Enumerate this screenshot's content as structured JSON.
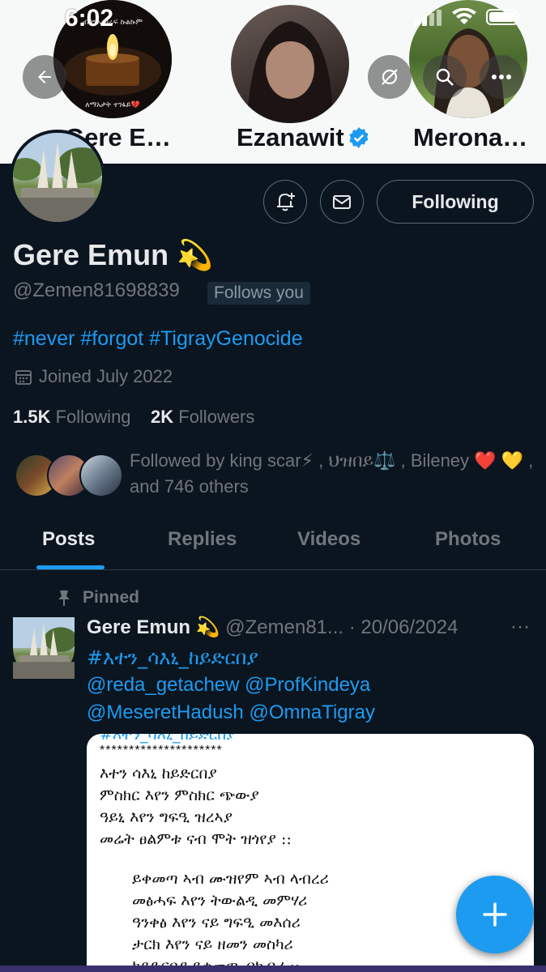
{
  "status_bar": {
    "time": "6:02"
  },
  "suggestions": [
    {
      "name": "Gere E…",
      "avatar_caption_top": "ብበግኡ ሀሬፍ ኩልኩም",
      "avatar_caption_bottom": "ለማአታት ተገፋይ💔"
    },
    {
      "name": "Ezanawit",
      "verified": true
    },
    {
      "name": "Merona…"
    }
  ],
  "header_buttons": [
    "back-icon",
    "hide-icon",
    "search-icon",
    "more-icon"
  ],
  "profile": {
    "display_name": "Gere Emun 💫",
    "handle": "@Zemen81698839",
    "follows_you": "Follows you",
    "bio": "#never #forgot #TigrayGenocide",
    "joined": "Joined July 2022",
    "following_count": "1.5K",
    "following_label": "Following",
    "followers_count": "2K",
    "followers_label": "Followers",
    "followed_by": "Followed by king scar⚡ , ህዝበይ⚖️ , Bileney ❤️ 💛 , and 746 others",
    "follow_button": "Following"
  },
  "tabs": [
    {
      "label": "Posts",
      "active": true
    },
    {
      "label": "Replies"
    },
    {
      "label": "Videos"
    },
    {
      "label": "Photos"
    }
  ],
  "tweet": {
    "pinned_label": "Pinned",
    "author": "Gere Emun 💫",
    "meta": "@Zemen81... · 20/06/2024",
    "more": "···",
    "lines": [
      "#እተን_ሳእኒ_ከይድርበያ",
      "@reda_getachew @ProfKindeya",
      "@MeseretHadush @OmnaTigray"
    ],
    "media": {
      "cut_header": "#እተን_ሳእኒ_ከይድርበያ",
      "stars": "*********************",
      "stanza1": [
        "እተን ሳእኒ ከይድርበያ",
        "ምስክር  እየን ምስክር ጭውያ",
        "ዓይኒ  እየን ግፍዒ ዝረኣያ",
        "መሬት ፀልምቱ ናብ ሞት ዝጎየያ ::"
      ],
      "stanza2": [
        "ይቀመጣ ኣብ ሙዝየም ኣብ ላብረሪ",
        "መፅሓፍ እየን ትውልዲ መምሃሪ",
        "ዓንቀፅ እየን ናይ ግፍዒ መእሰሪ",
        "ታርክ እየን ናይ ዘመን መስካሪ",
        "ከይድርበያ ይቀመጣ ብክብሪ ::"
      ]
    }
  },
  "fab": {
    "icon": "plus-icon"
  },
  "colors": {
    "accent": "#1d9bf0",
    "background": "#0a1520",
    "header": "#f7f9f9"
  }
}
